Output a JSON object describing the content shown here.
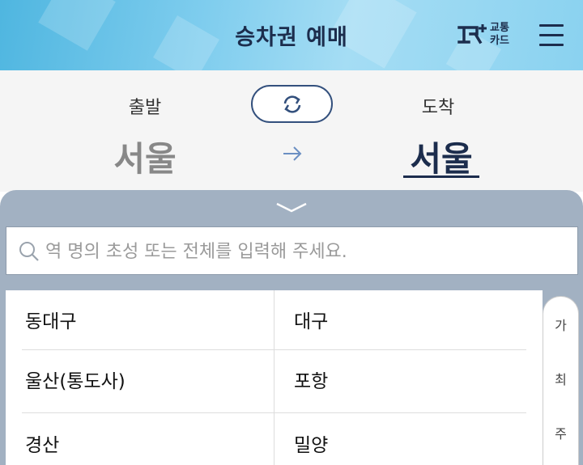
{
  "header": {
    "title": "승차권 예매",
    "logo_text": "교통 카드"
  },
  "route": {
    "departure_label": "출발",
    "arrival_label": "도착",
    "departure_city": "서울",
    "arrival_city": "서울"
  },
  "search": {
    "placeholder": "역 명의 초성 또는 전체를 입력해 주세요."
  },
  "stations": [
    [
      "동대구",
      "대구"
    ],
    [
      "울산(통도사)",
      "포항"
    ],
    [
      "경산",
      "밀양"
    ]
  ],
  "index": [
    "가",
    "최",
    "주"
  ],
  "colors": {
    "navy": "#1c2d4d",
    "sheet": "#a2b1c2",
    "header_accent": "#7fcdee"
  }
}
